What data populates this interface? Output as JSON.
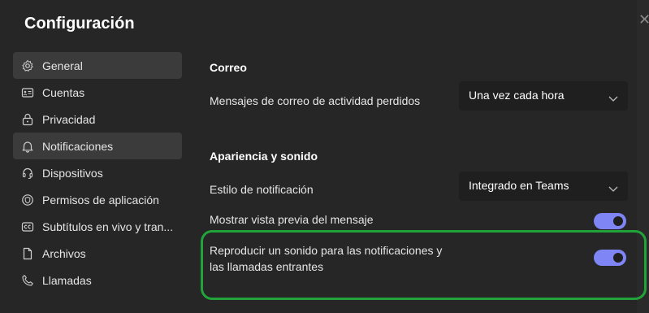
{
  "window": {
    "title": "Configuración"
  },
  "sidebar": {
    "items": [
      {
        "label": "General",
        "icon": "gear-icon",
        "active": false,
        "selected_hover": true
      },
      {
        "label": "Cuentas",
        "icon": "id-card-icon"
      },
      {
        "label": "Privacidad",
        "icon": "lock-icon"
      },
      {
        "label": "Notificaciones",
        "icon": "bell-icon",
        "active": true
      },
      {
        "label": "Dispositivos",
        "icon": "headset-icon"
      },
      {
        "label": "Permisos de aplicación",
        "icon": "shield-icon"
      },
      {
        "label": "Subtítulos en vivo y tran...",
        "icon": "captions-icon"
      },
      {
        "label": "Archivos",
        "icon": "file-icon"
      },
      {
        "label": "Llamadas",
        "icon": "phone-icon"
      }
    ]
  },
  "main": {
    "email_section": {
      "title": "Correo",
      "missed_activity_label": "Mensajes de correo de actividad perdidos",
      "missed_activity_value": "Una vez cada hora"
    },
    "appearance_section": {
      "title": "Apariencia y sonido",
      "style_label": "Estilo de notificación",
      "style_value": "Integrado en Teams",
      "preview_label": "Mostrar vista previa del mensaje",
      "preview_on": true,
      "sound_label_line1": "Reproducir un sonido para las notificaciones y",
      "sound_label_line2": "las llamadas entrantes",
      "sound_on": true
    }
  },
  "colors": {
    "accent": "#7f85f5",
    "highlight_border": "#22a33a",
    "background": "#262626"
  }
}
